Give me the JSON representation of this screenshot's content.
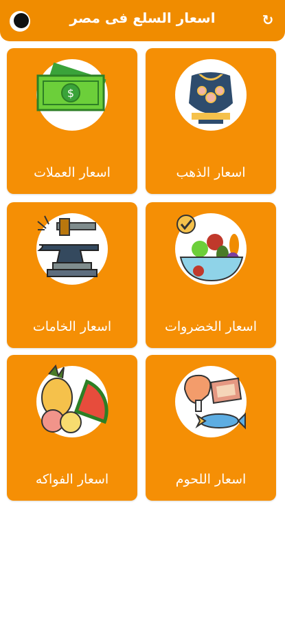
{
  "app": {
    "title": "اسعار السلع فى مصر"
  },
  "colors": {
    "accent": "#f08c00",
    "card": "#f58f05",
    "text": "#ffffff"
  },
  "icons": {
    "refresh": "refresh-icon",
    "theme": "moon-icon"
  },
  "cards": [
    {
      "label": "اسعار الذهب",
      "icon": "gold-jewelry-icon"
    },
    {
      "label": "اسعار العملات",
      "icon": "money-bill-icon"
    },
    {
      "label": "اسعار الخضروات",
      "icon": "vegetables-bowl-icon"
    },
    {
      "label": "اسعار الخامات",
      "icon": "anvil-hammer-icon"
    },
    {
      "label": "اسعار اللحوم",
      "icon": "meat-fish-icon"
    },
    {
      "label": "اسعار الفواكه",
      "icon": "fruits-icon"
    }
  ]
}
